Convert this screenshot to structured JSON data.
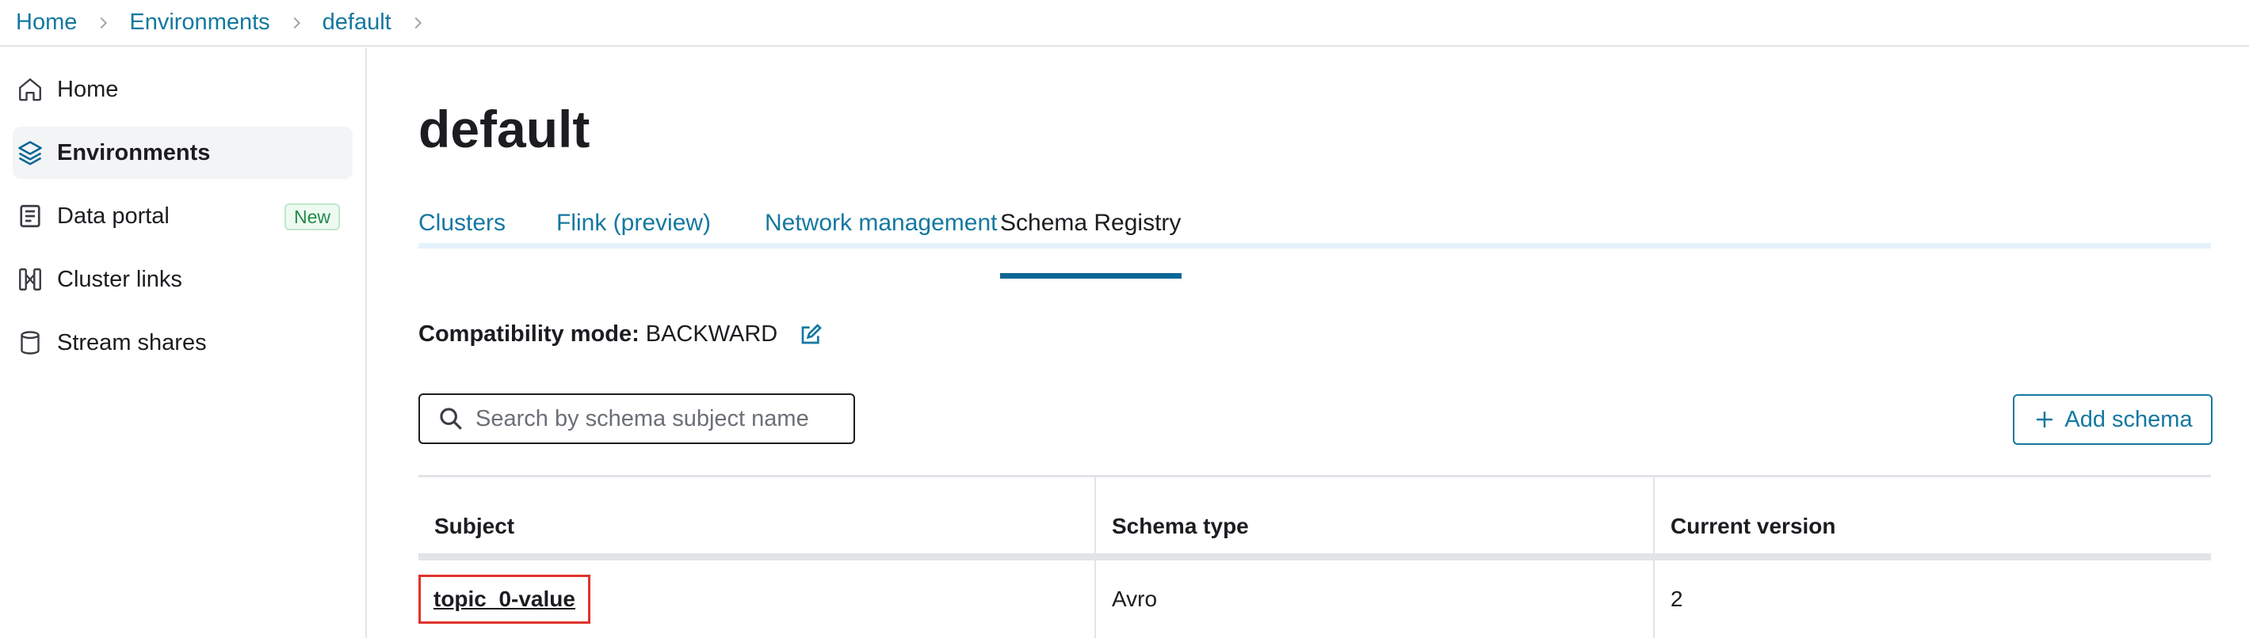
{
  "breadcrumb": [
    {
      "label": "Home"
    },
    {
      "label": "Environments"
    },
    {
      "label": "default"
    }
  ],
  "sidebar": {
    "items": [
      {
        "label": "Home",
        "icon": "home-icon"
      },
      {
        "label": "Environments",
        "icon": "layers-icon",
        "active": true
      },
      {
        "label": "Data portal",
        "icon": "document-icon",
        "badge": "New"
      },
      {
        "label": "Cluster links",
        "icon": "cluster-links-icon"
      },
      {
        "label": "Stream shares",
        "icon": "database-icon"
      }
    ]
  },
  "main": {
    "title": "default",
    "tabs": [
      {
        "label": "Clusters"
      },
      {
        "label": "Flink (preview)"
      },
      {
        "label": "Network management"
      },
      {
        "label": "Schema Registry",
        "active": true
      }
    ],
    "compatibility": {
      "label": "Compatibility mode:",
      "value": "BACKWARD"
    },
    "search": {
      "placeholder": "Search by schema subject name",
      "value": ""
    },
    "add_schema_label": "Add schema",
    "table": {
      "headers": [
        "Subject",
        "Schema type",
        "Current version"
      ],
      "rows": [
        {
          "subject": "topic_0-value",
          "schema_type": "Avro",
          "current_version": "2"
        }
      ]
    }
  },
  "colors": {
    "link": "#1478a0",
    "tab_indicator": "#0b6796",
    "highlight_border": "#e0332c",
    "badge_text": "#1f8a49"
  }
}
